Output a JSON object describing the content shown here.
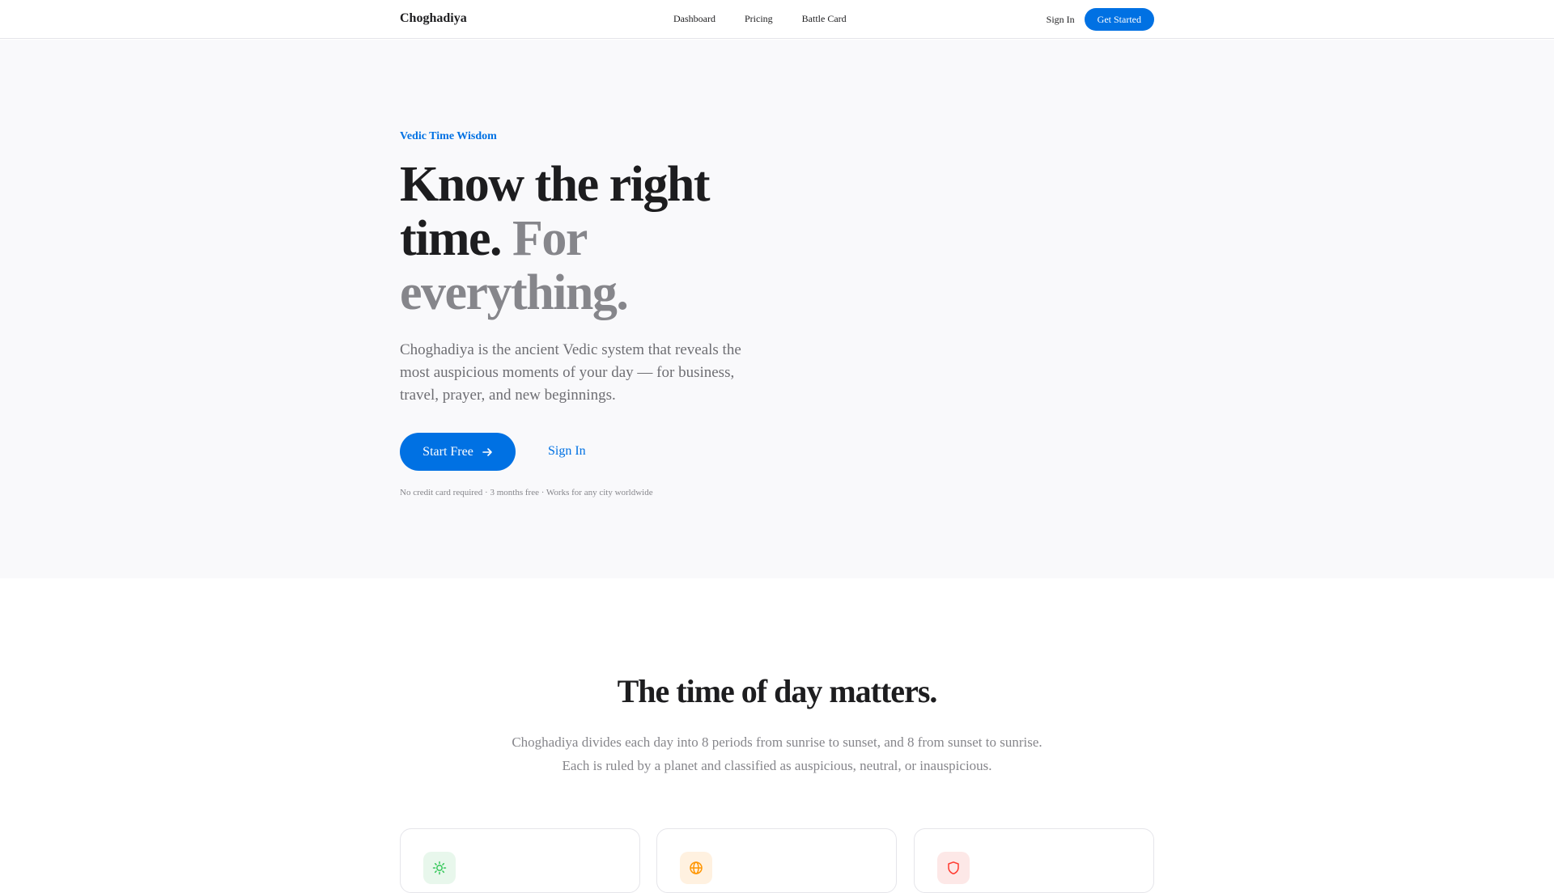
{
  "nav": {
    "brand": "Choghadiya",
    "links": [
      "Dashboard",
      "Pricing",
      "Battle Card"
    ],
    "signin": "Sign In",
    "cta": "Get Started"
  },
  "hero": {
    "eyebrow": "Vedic Time Wisdom",
    "headline_dark": "Know the right time.",
    "headline_muted": "For everything.",
    "lede": "Choghadiya is the ancient Vedic system that reveals the most auspicious moments of your day — for business, travel, prayer, and new beginnings.",
    "start_label": "Start Free",
    "signin_label": "Sign In",
    "fineprint": "No credit card required · 3 months free · Works for any city worldwide"
  },
  "section": {
    "title": "The time of day matters.",
    "subtitle": "Choghadiya divides each day into 8 periods from sunrise to sunset, and 8 from sunset to sunrise. Each is ruled by a planet and classified as auspicious, neutral, or inauspicious."
  },
  "cards": [
    {
      "icon": "sun-icon",
      "icon_color": "#34c759",
      "bg": "#e8f7ec"
    },
    {
      "icon": "globe-icon",
      "icon_color": "#ff9500",
      "bg": "#fff1e0"
    },
    {
      "icon": "shield-icon",
      "icon_color": "#ff3b30",
      "bg": "#fde8e7"
    }
  ],
  "colors": {
    "accent": "#0071e3",
    "text": "#1d1d1f",
    "muted": "#86868b"
  }
}
